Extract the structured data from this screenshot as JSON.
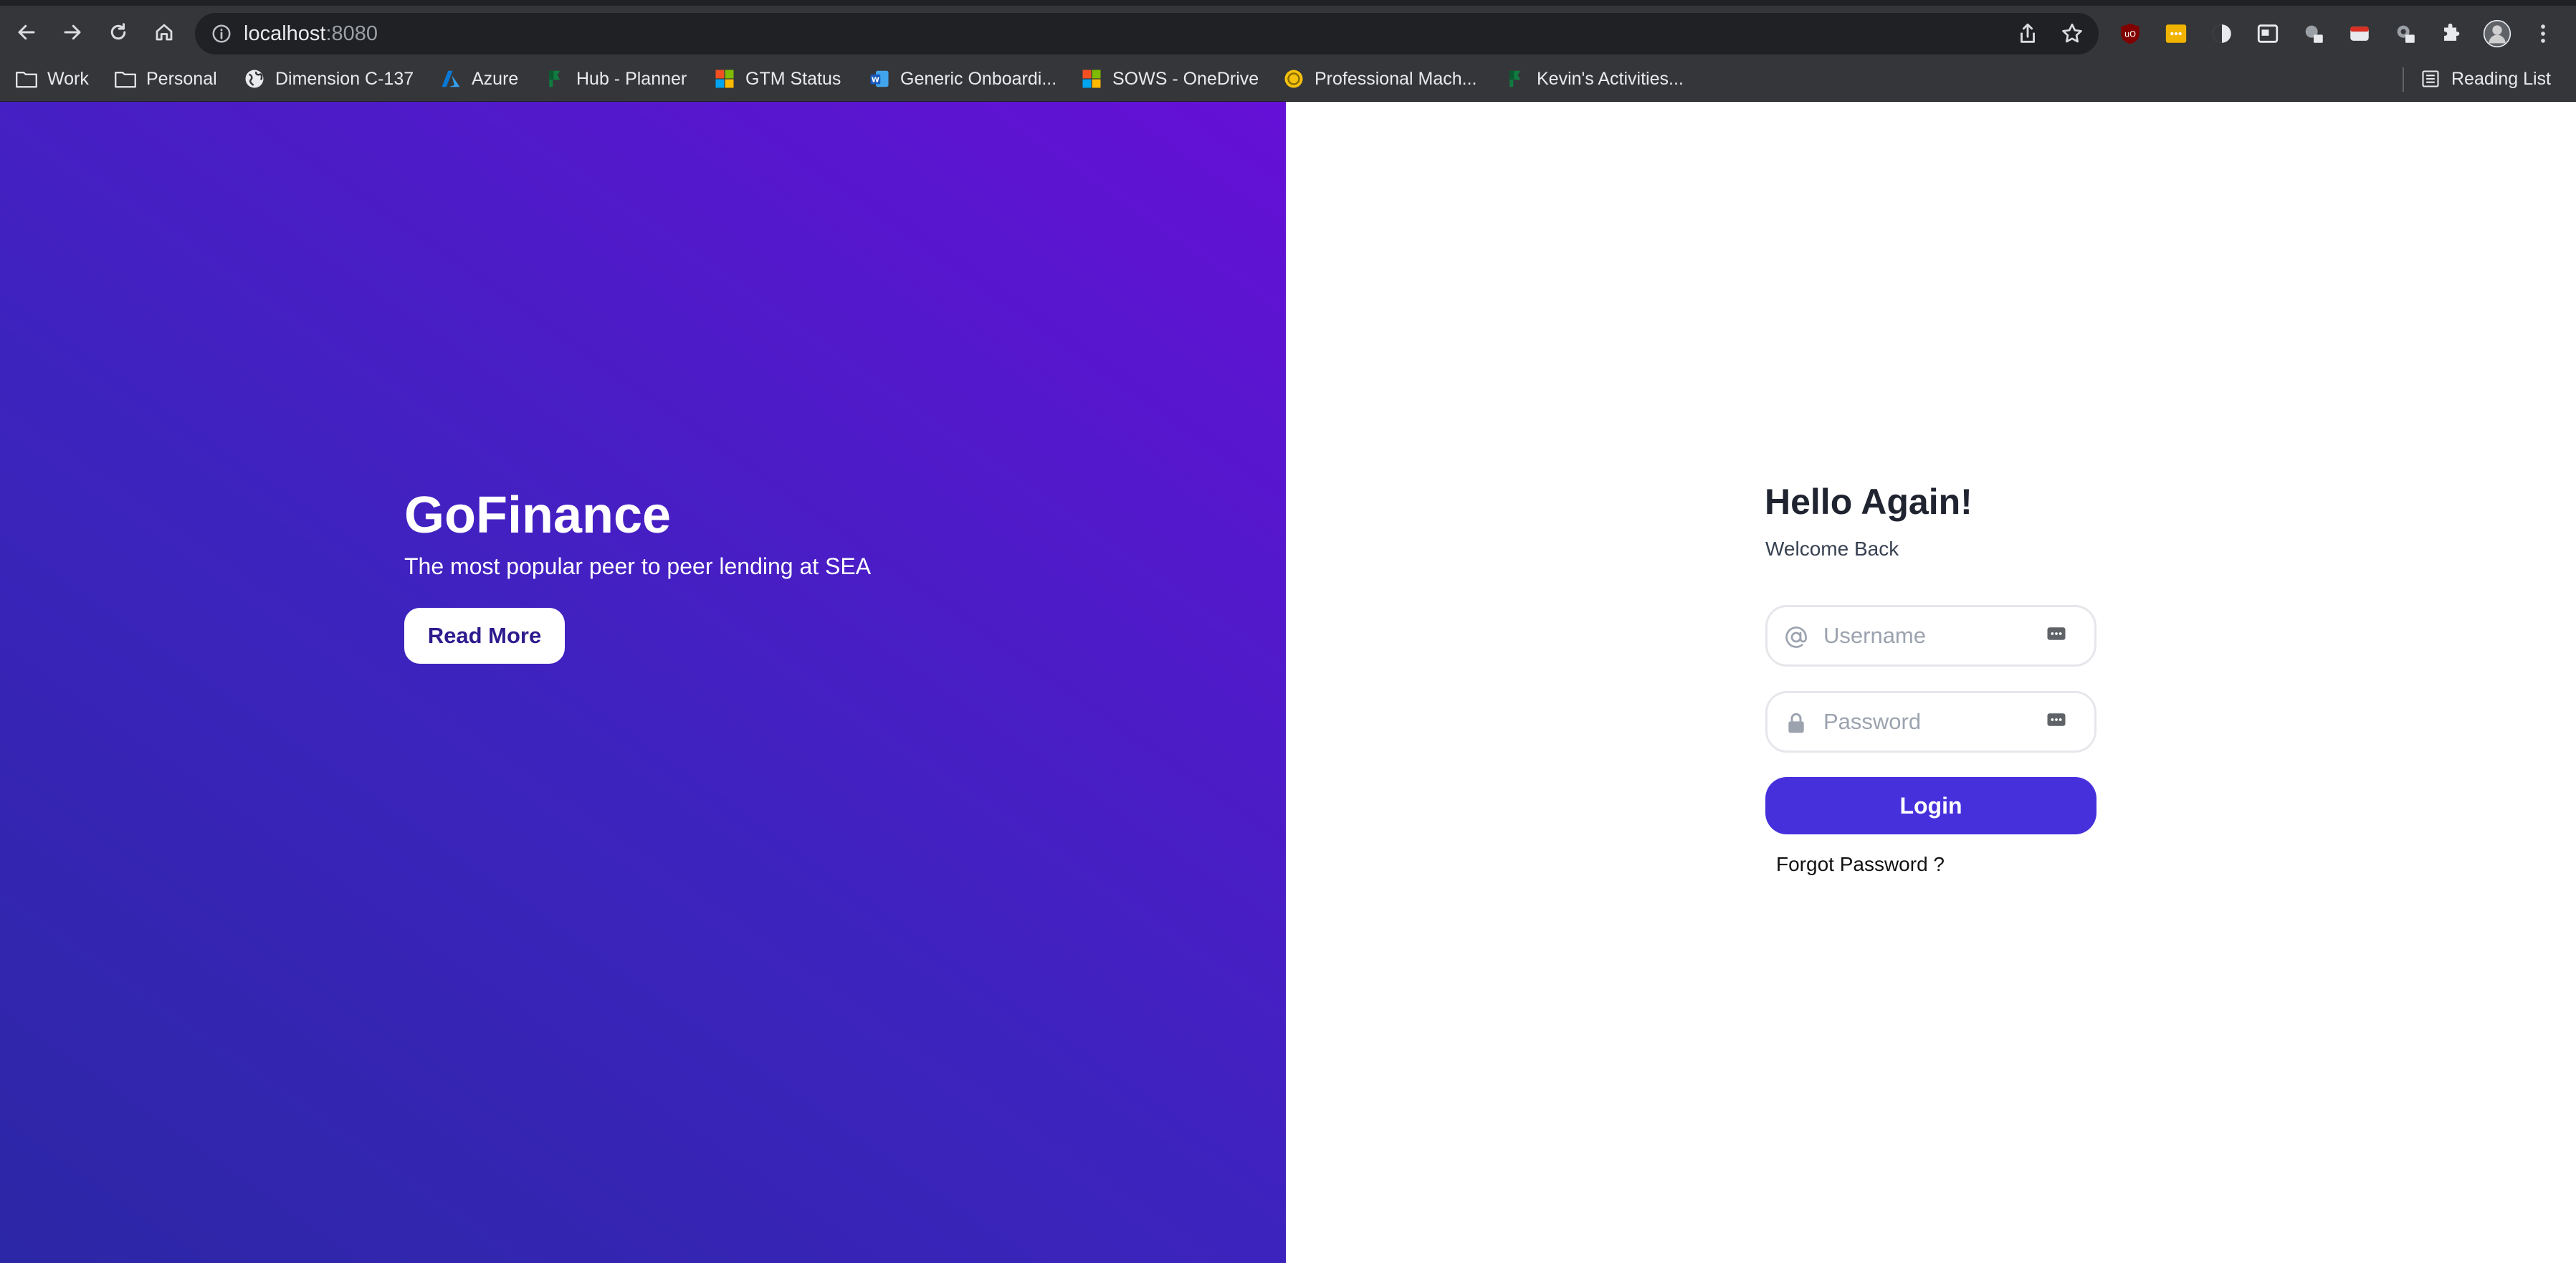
{
  "browser": {
    "url_host": "localhost",
    "url_port": ":8080",
    "bookmarks": [
      {
        "label": "Work",
        "icon": "folder-icon"
      },
      {
        "label": "Personal",
        "icon": "folder-icon"
      },
      {
        "label": "Dimension C-137",
        "icon": "globe-icon"
      },
      {
        "label": "Azure",
        "icon": "azure-icon"
      },
      {
        "label": "Hub - Planner",
        "icon": "planner-icon"
      },
      {
        "label": "GTM Status",
        "icon": "microsoft-icon"
      },
      {
        "label": "Generic Onboardi...",
        "icon": "word-icon"
      },
      {
        "label": "SOWS - OneDrive",
        "icon": "microsoft-icon"
      },
      {
        "label": "Professional Mach...",
        "icon": "coin-icon"
      },
      {
        "label": "Kevin's Activities...",
        "icon": "planner-icon"
      }
    ],
    "reading_list": "Reading List"
  },
  "hero": {
    "title": "GoFinance",
    "subtitle": "The most popular peer to peer lending at SEA",
    "button": "Read More"
  },
  "login": {
    "title": "Hello Again!",
    "subtitle": "Welcome Back",
    "username_placeholder": "Username",
    "password_placeholder": "Password",
    "submit": "Login",
    "forgot": "Forgot Password ?"
  },
  "colors": {
    "hero_gradient_start": "#2c27a6",
    "hero_gradient_end": "#6510d6",
    "primary_button": "#4630dc",
    "chrome_bg": "#35363a"
  }
}
